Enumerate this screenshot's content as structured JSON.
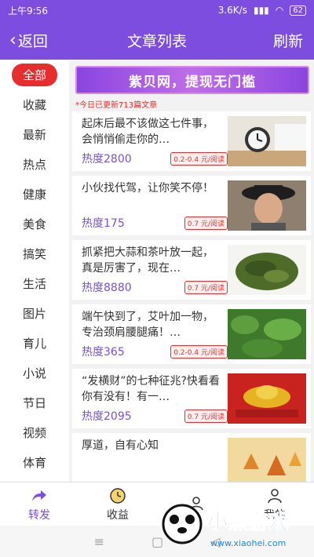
{
  "status": {
    "time": "上午9:56",
    "speed": "3.6K/s",
    "battery": "62"
  },
  "header": {
    "back_label": "返回",
    "title": "文章列表",
    "refresh_label": "刷新"
  },
  "sidebar": {
    "items": [
      {
        "label": "全部"
      },
      {
        "label": "收藏"
      },
      {
        "label": "最新"
      },
      {
        "label": "热点"
      },
      {
        "label": "健康"
      },
      {
        "label": "美食"
      },
      {
        "label": "搞笑"
      },
      {
        "label": "生活"
      },
      {
        "label": "图片"
      },
      {
        "label": "育儿"
      },
      {
        "label": "小说"
      },
      {
        "label": "节日"
      },
      {
        "label": "视频"
      },
      {
        "label": "体育"
      }
    ]
  },
  "banner": {
    "text": "紫贝网，提现无门槛"
  },
  "notice": "*今日已更新713篇文章",
  "articles": [
    {
      "headline": "起床后最不该做这七件事，会悄悄偷走你的…",
      "heat": "热度2800",
      "rate": "0.2-0.4 元/阅读",
      "thumb": "alarm-clock-photo"
    },
    {
      "headline": "小伙找代驾，让你笑不停！",
      "heat": "热度175",
      "rate": "0.7 元/阅读",
      "thumb": "person-hat-photo"
    },
    {
      "headline": "抓紧把大蒜和茶叶放一起，真是厉害了，现在…",
      "heat": "热度8880",
      "rate": "0.7 元/阅读",
      "thumb": "tea-leaves-photo"
    },
    {
      "headline": "端午快到了，艾叶加一物，专治颈肩腰腿痛！…",
      "heat": "热度365",
      "rate": "0.2-0.4 元/阅读",
      "thumb": "mugwort-photo"
    },
    {
      "headline": "“发横财”的七种征兆?快看看你有没有！有一…",
      "heat": "热度2095",
      "rate": "0.7 元/阅读",
      "thumb": "gold-ingot-photo"
    },
    {
      "headline": "厚道，自有心知",
      "heat": "",
      "rate": "",
      "thumb": "autumn-leaves-photo"
    }
  ],
  "tabs": [
    {
      "label": "转发",
      "icon": "share-icon"
    },
    {
      "label": "收益",
      "icon": "clock-coin-icon"
    },
    {
      "label": "",
      "icon": "team-icon"
    },
    {
      "label": "我的",
      "icon": "user-icon"
    }
  ],
  "watermark": {
    "text": "小黑游戏",
    "url": "www.xiaohei.com"
  },
  "colors": {
    "accent": "#7c4dde",
    "badge": "#e62e2e"
  }
}
